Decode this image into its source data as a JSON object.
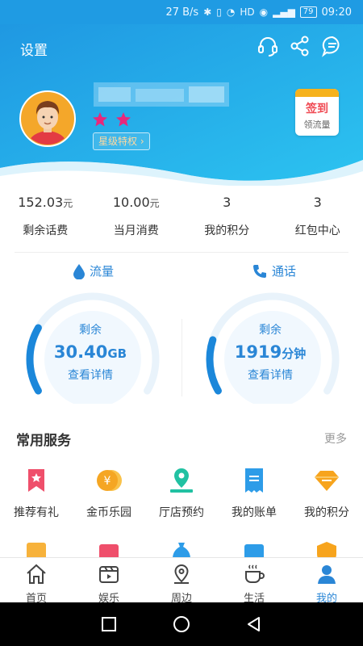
{
  "status_bar": {
    "speed": "27 B/s",
    "battery": "79",
    "time": "09:20"
  },
  "header": {
    "settings_label": "设置",
    "privilege_label": "星级特权",
    "signin": {
      "main": "签到",
      "sub": "领流量"
    },
    "star_count": 2
  },
  "stats": [
    {
      "value": "152.03",
      "unit": "元",
      "label": "剩余话费"
    },
    {
      "value": "10.00",
      "unit": "元",
      "label": "当月消费"
    },
    {
      "value": "3",
      "unit": "",
      "label": "我的积分"
    },
    {
      "value": "3",
      "unit": "",
      "label": "红包中心"
    }
  ],
  "gauges": {
    "data": {
      "title": "流量",
      "label": "剩余",
      "value": "30.40",
      "unit": "GB",
      "link": "查看详情",
      "fill": 0.25
    },
    "call": {
      "title": "通话",
      "label": "剩余",
      "value": "1919",
      "unit": "分钟",
      "link": "查看详情",
      "fill": 0.2
    }
  },
  "services": {
    "title": "常用服务",
    "more": "更多",
    "items": [
      {
        "label": "推荐有礼",
        "icon": "bookmark-star-icon"
      },
      {
        "label": "金币乐园",
        "icon": "coin-icon"
      },
      {
        "label": "厅店预约",
        "icon": "store-location-icon"
      },
      {
        "label": "我的账单",
        "icon": "bill-icon"
      },
      {
        "label": "我的积分",
        "icon": "diamond-icon"
      }
    ]
  },
  "tabs": [
    {
      "label": "首页",
      "icon": "home-icon"
    },
    {
      "label": "娱乐",
      "icon": "video-icon"
    },
    {
      "label": "周边",
      "icon": "location-icon"
    },
    {
      "label": "生活",
      "icon": "coffee-icon"
    },
    {
      "label": "我的",
      "icon": "person-icon",
      "active": true
    }
  ],
  "colors": {
    "accent": "#2a86d6",
    "header_blue": "#22a6e8",
    "star": "#e8287c"
  }
}
